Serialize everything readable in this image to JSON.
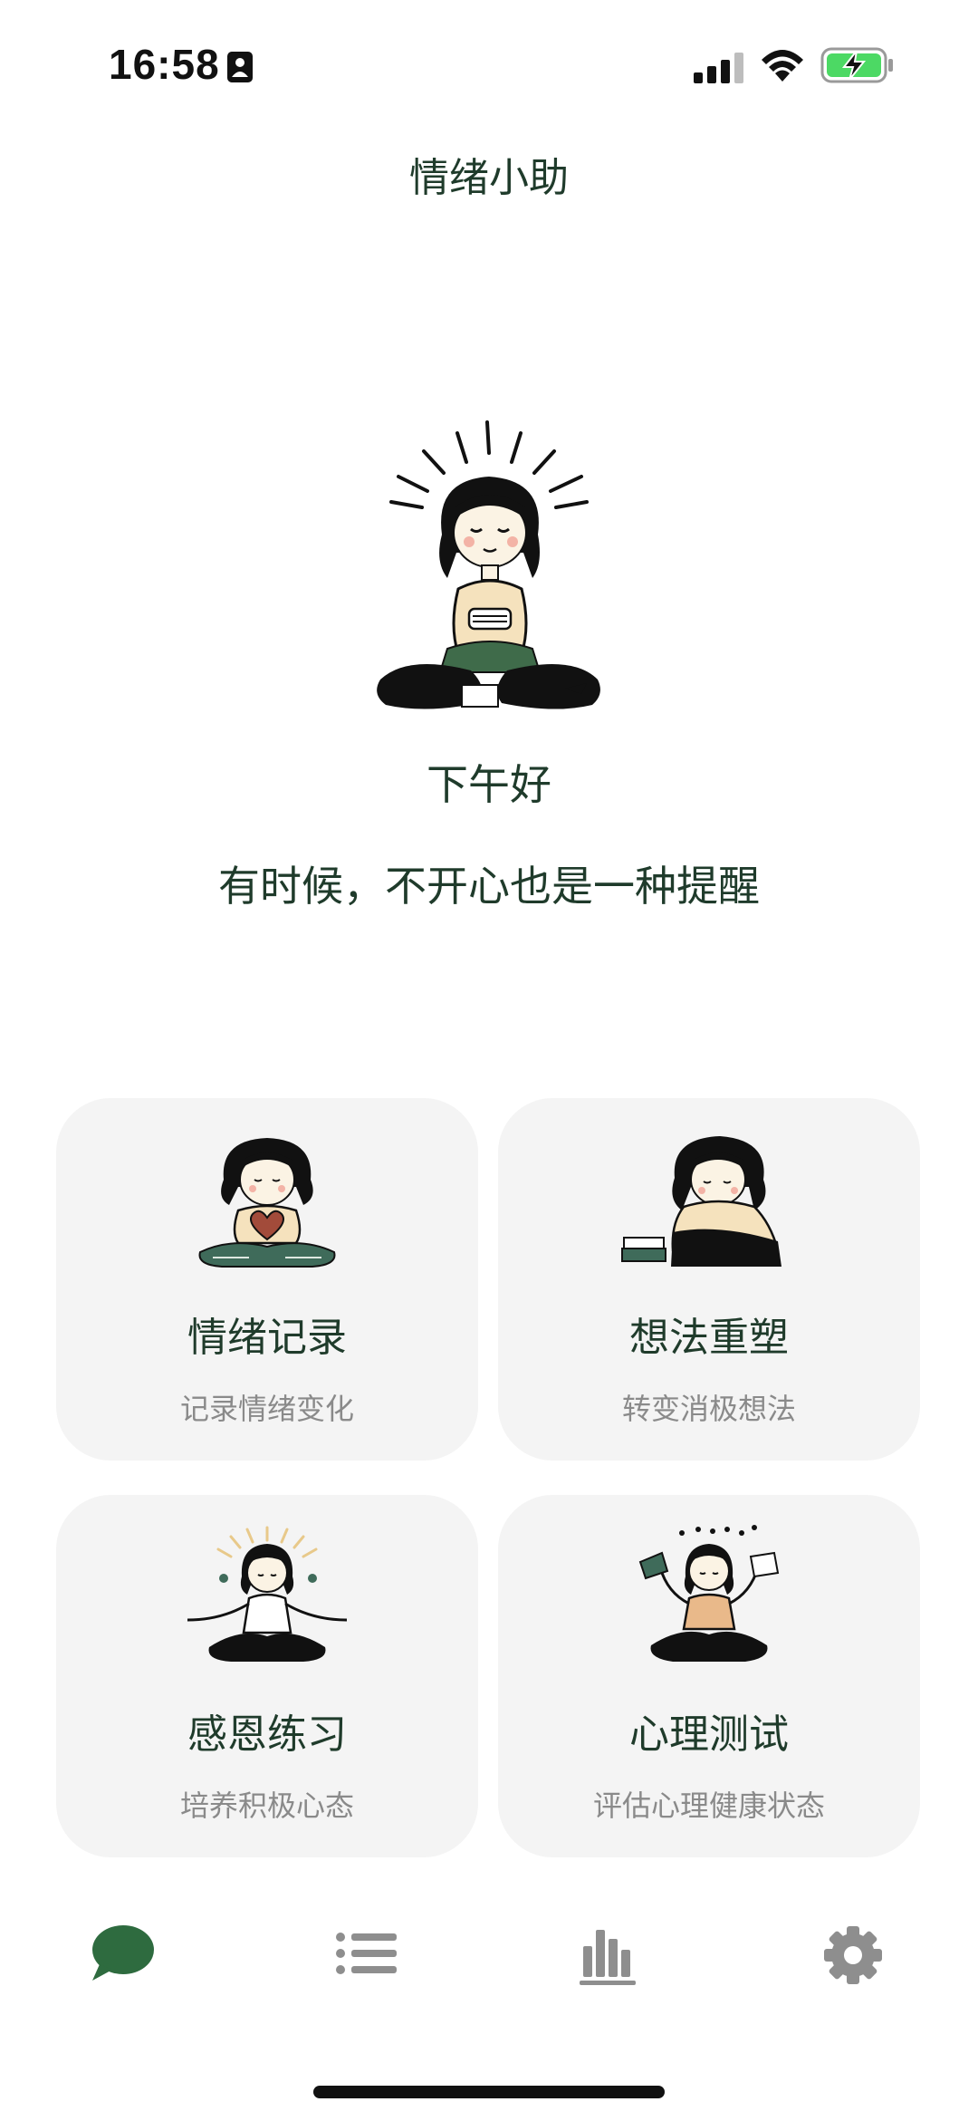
{
  "status_bar": {
    "time": "16:58",
    "icons": [
      "contact-card-icon",
      "cellular-signal-icon",
      "wifi-icon",
      "battery-charging-icon"
    ],
    "battery_color": "#4cd964"
  },
  "app": {
    "title": "情绪小助",
    "greeting": "下午好",
    "quote": "有时候，不开心也是一种提醒"
  },
  "cards": [
    {
      "title": "情绪记录",
      "subtitle": "记录情绪变化",
      "icon": "girl-holding-heart-illustration"
    },
    {
      "title": "想法重塑",
      "subtitle": "转变消极想法",
      "icon": "girl-thinking-illustration"
    },
    {
      "title": "感恩练习",
      "subtitle": "培养积极心态",
      "icon": "girl-meditating-illustration"
    },
    {
      "title": "心理测试",
      "subtitle": "评估心理健康状态",
      "icon": "girl-holding-books-illustration"
    }
  ],
  "tab_bar": {
    "items": [
      {
        "icon": "chat-bubble-icon",
        "active": true
      },
      {
        "icon": "list-icon",
        "active": false
      },
      {
        "icon": "bar-chart-icon",
        "active": false
      },
      {
        "icon": "gear-icon",
        "active": false
      }
    ],
    "active_color": "#2e6b3f",
    "inactive_color": "#8e8e8e"
  },
  "colors": {
    "accent": "#2e6b3f",
    "text_primary": "#1f3b2b",
    "text_secondary": "#8a8a8a",
    "card_background": "#f4f4f4"
  }
}
